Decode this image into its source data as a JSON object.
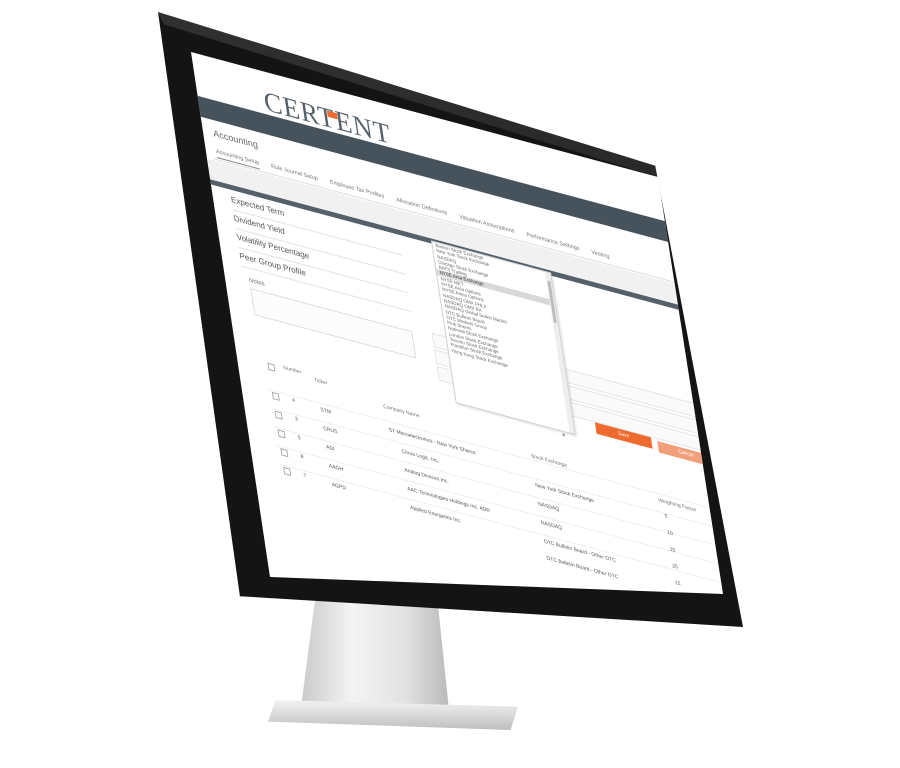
{
  "app": {
    "logo_text": "CERTENT"
  },
  "page": {
    "title": "Accounting"
  },
  "tabs": [
    {
      "label": "Accounting Setup",
      "active": true
    },
    {
      "label": "Rule Journal Setup"
    },
    {
      "label": "Employee Tax Profiles"
    },
    {
      "label": "Allocation Definitions"
    },
    {
      "label": "Valuation Assumptions"
    },
    {
      "label": "Performance Settings"
    },
    {
      "label": "Vesting"
    }
  ],
  "parameters": [
    {
      "label": "Expected Term"
    },
    {
      "label": "Dividend Yield"
    },
    {
      "label": "Volatility Percentage"
    },
    {
      "label": "Peer Group Profile"
    }
  ],
  "notes": {
    "label": "Notes"
  },
  "exchange_dropdown": {
    "items": [
      "Boston Stock Exchange",
      "New York Stock Exchange",
      "NASDAQ",
      "Chicago Stock Exchange",
      "BATS Trading",
      "NYSE Arca Exchange",
      "NYSE MKT",
      "NYSE Arca Options",
      "NYSE Amex Options",
      "NASDAQ OMX PHLX",
      "NASDAQ OMX BX",
      "NASDAQ Global Select Market",
      "OTC Bulletin Board",
      "OTC Markets Group",
      "Pink Sheets",
      "National Stock Exchange",
      "London Stock Exchange",
      "Toronto Stock Exchange",
      "Frankfurt Stock Exchange",
      "Hong Kong Stock Exchange"
    ],
    "selected_index": 5
  },
  "buttons": {
    "primary": "Save",
    "secondary": "Cancel"
  },
  "table": {
    "headers": {
      "number": "Number",
      "ticker": "Ticker",
      "company": "Company Name",
      "exchange": "Stock Exchange",
      "weight": "Weighting Factor"
    },
    "rows": [
      {
        "number": "4",
        "ticker": "STM",
        "company": "ST Microelectronics - New York Shares",
        "exchange": "New York Stock Exchange",
        "weight": "5"
      },
      {
        "number": "3",
        "ticker": "CRUS",
        "company": "Cirrus Logic, Inc.",
        "exchange": "NASDAQ",
        "weight": "10"
      },
      {
        "number": "5",
        "ticker": "ADI",
        "company": "Analog Devices Inc.",
        "exchange": "NASDAQ",
        "weight": "15"
      },
      {
        "number": "8",
        "ticker": "AAGH",
        "company": "AAC Technologies Holdings Inc. ADR",
        "exchange": "OTC Bulletin Board - Other OTC",
        "weight": "25"
      },
      {
        "number": "7",
        "ticker": "AGPD",
        "company": "Applied Energetics Inc.",
        "exchange": "OTC Bulletin Board - Other OTC",
        "weight": "15"
      }
    ]
  },
  "colors": {
    "accent": "#ef6a2e",
    "header_band": "#46535c"
  }
}
